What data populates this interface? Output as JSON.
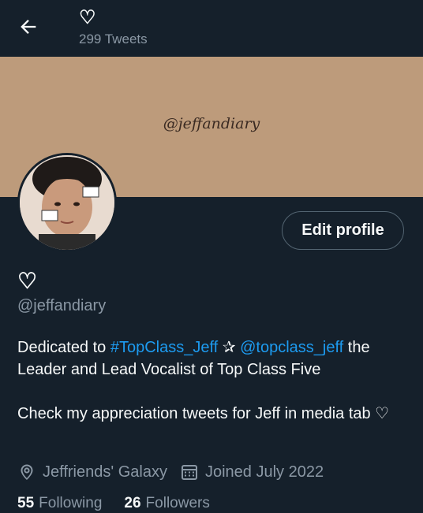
{
  "header": {
    "back_icon": "arrow-left-icon",
    "display_name": "♡",
    "tweet_count": "299 Tweets"
  },
  "banner": {
    "text": "@jeffandiary"
  },
  "profile": {
    "edit_button": "Edit profile",
    "display_name": "♡",
    "handle": "@jeffandiary",
    "bio": {
      "line1_prefix": "Dedicated to ",
      "hashtag": "#TopClass_Jeff",
      "star": " ✰ ",
      "mention": "@topclass_jeff",
      "line1_suffix": " the Leader and Lead Vocalist of Top Class Five",
      "line2": "Check my appreciation tweets for Jeff in media tab ♡"
    },
    "location": "Jeffriends' Galaxy",
    "joined": "Joined July 2022",
    "following_count": "55",
    "following_label": "Following",
    "followers_count": "26",
    "followers_label": "Followers"
  },
  "icons": {
    "location": "location-pin-icon",
    "calendar": "calendar-icon"
  },
  "colors": {
    "background": "#15202b",
    "accent": "#1d9bf0",
    "secondary_text": "#8b98a5",
    "banner": "#bd9b7b"
  }
}
